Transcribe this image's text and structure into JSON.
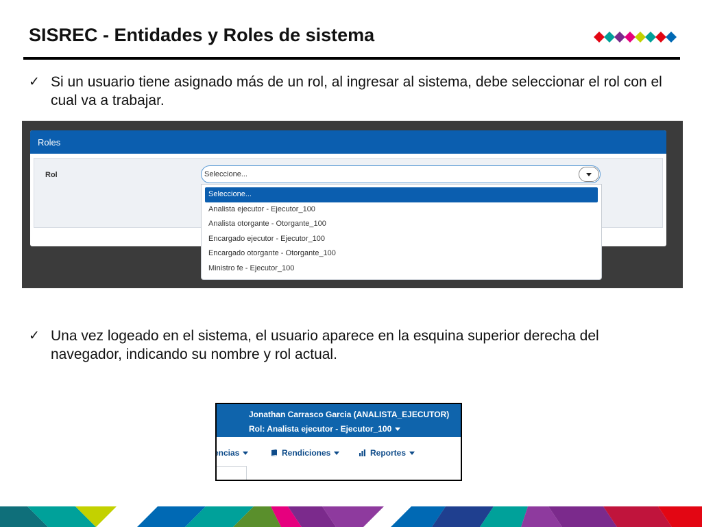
{
  "slide": {
    "title": "SISREC - Entidades y Roles de sistema",
    "brand_colors": [
      "#e6007e",
      "#00a19a",
      "#7b2a8c",
      "#e6007e",
      "#c3d100",
      "#00a19a",
      "#e30613",
      "#0069b4"
    ]
  },
  "bullets": [
    {
      "icon": "checkmark-icon",
      "text": "Si un usuario tiene asignado más de un rol, al ingresar al sistema, debe seleccionar el rol con el cual va a trabajar."
    },
    {
      "icon": "checkmark-icon",
      "text": "Una vez logeado en el sistema, el usuario aparece en la esquina superior derecha del navegador, indicando su nombre y rol actual."
    }
  ],
  "roles_screenshot": {
    "panel_title": "Roles",
    "field_label": "Rol",
    "select_value": "Seleccione...",
    "options": [
      "Seleccione...",
      "Analista ejecutor - Ejecutor_100",
      "Analista otorgante - Otorgante_100",
      "Encargado ejecutor - Ejecutor_100",
      "Encargado otorgante - Otorgante_100",
      "Ministro fe - Ejecutor_100"
    ],
    "selected_option": "Seleccione...",
    "accent_color": "#0b5eaf"
  },
  "user_screenshot": {
    "user_name": "Jonathan Carrasco Garcia (ANALISTA_EJECUTOR)",
    "role_label": "Rol: Analista ejecutor - Ejecutor_100",
    "nav_items": [
      {
        "label": "encias",
        "icon": ""
      },
      {
        "label": "Rendiciones",
        "icon": "book-icon"
      },
      {
        "label": "Reportes",
        "icon": "bar-chart-icon"
      }
    ],
    "header_color": "#0f64ac"
  }
}
